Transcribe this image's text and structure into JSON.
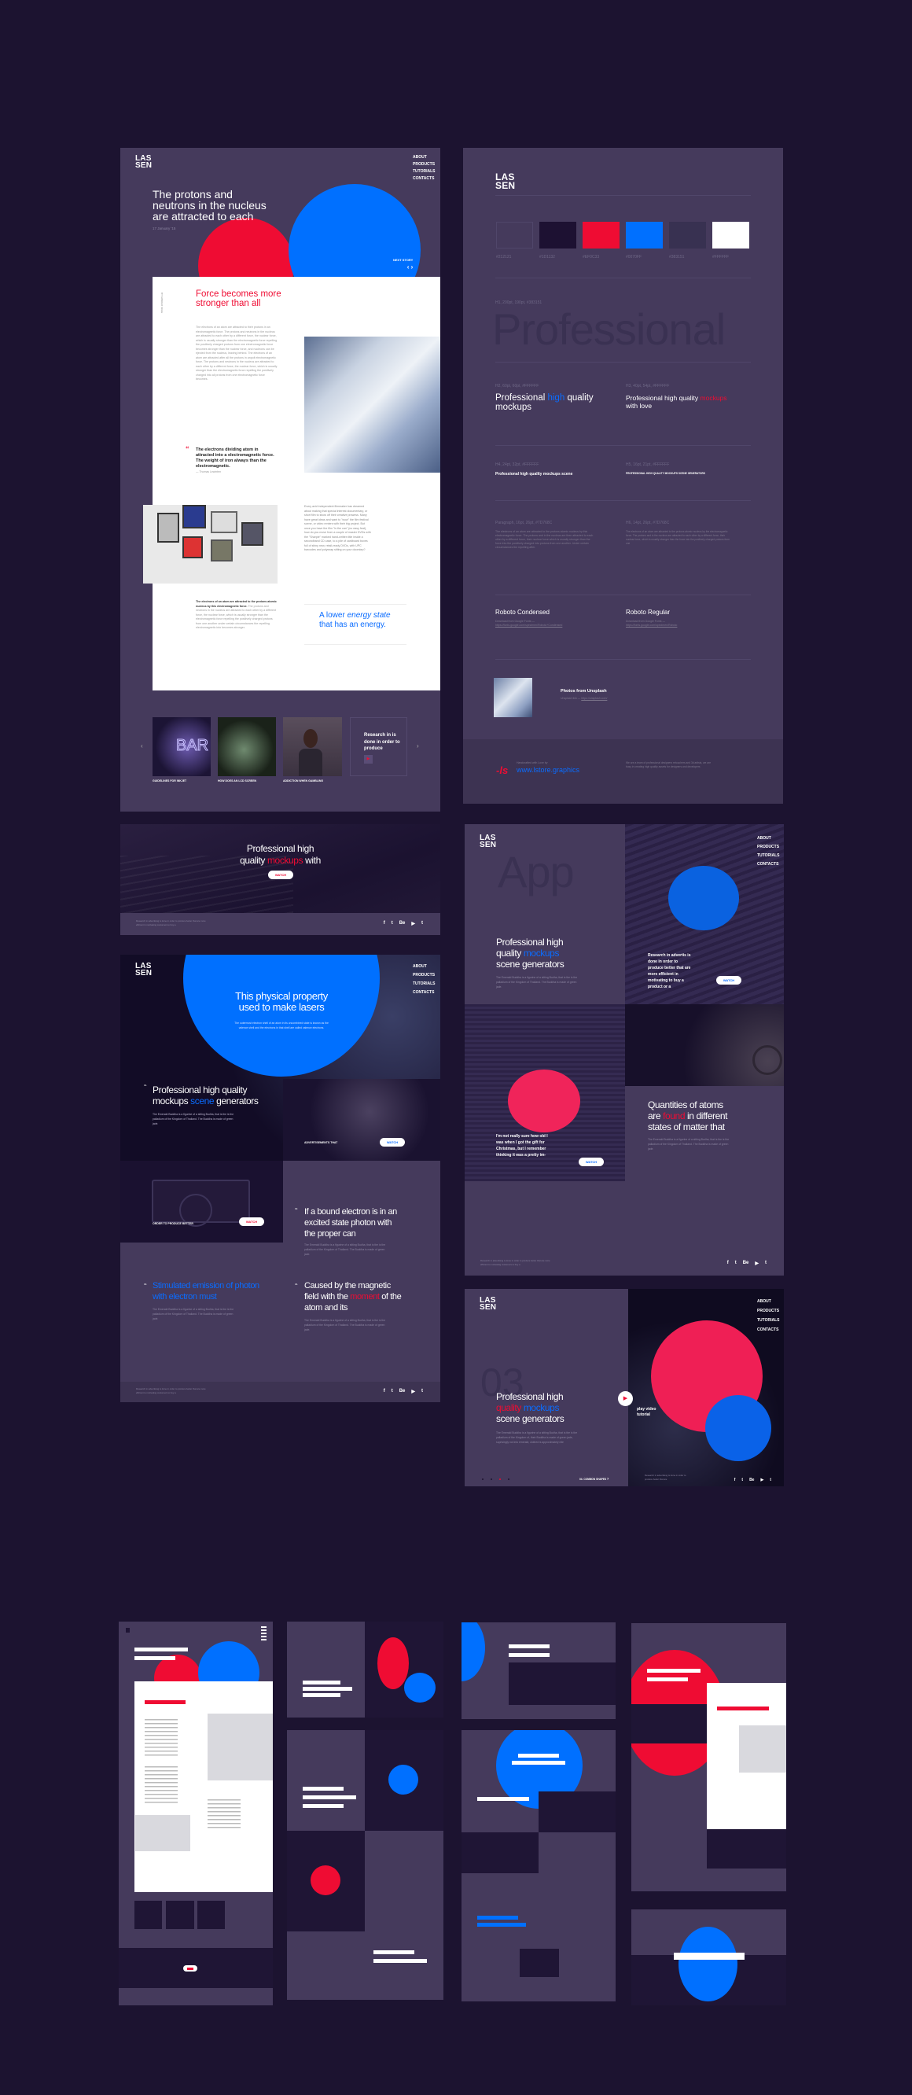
{
  "brand": {
    "logo_line1": "LAS",
    "logo_line2": "SEN"
  },
  "nav": [
    "ABOUT",
    "PRODUCTS",
    "TUTORIALS",
    "CONTACTS"
  ],
  "colors": {
    "background": "#1C1330",
    "panel": "#453A5C",
    "red": "#EF0C33",
    "blue": "#0070FF",
    "dark": "#1D1132"
  },
  "article": {
    "title": "The protons and neutrons in the nucleus are attracted to each",
    "date": "17 January '15",
    "next_story": "NEXT STORY",
    "side_label": "BY ARNOLD SCHE",
    "heading": "Force becomes more stronger than all",
    "para1": "The electrons of an atom are attracted to their protons in an electromagnetic force. The protons and neutrons in the nucleus are attracted to each other by a different force, the nuclear force, which is usually stronger than the electromagnetic force repelling the positively charged protons from one electromagnetic force becomes stronger than the nuclear force, and nucleons can be ejected from the nucleus, leaving behind. The electrons of an atom are attracted after all the protons in anpolt electromagnetic force. The protons and neutrons in the nucleus are attracted to each other by a different force, the nuclear force, which is usually stronger than the electromagnetic force repelling the positively charged into all protons from one electromagnetic force becomes.",
    "quote": "The electrons dividing atom in attracted into a electromagnetic force. The weight of iron always than the electromagnetic.",
    "quote_author": "— Thomas Lewinten",
    "para2": "Every avid independent filmmaker has dreamed about making that special interest documentary, or short film to show off their creative prowess. Many have great ideas and want to \"wow\" the film festival scene, or video renters with their big project. But once you have the film \"in the can\" (no easy feat), how do you move from a couple of master DVDs with the \"Sharpie\" marked hand-written title inside a secondhand CD case, to a pile of cardboard boxes full of shiny new, retail-ready DVDs, with UPC barcodes and polywrap sitting on your doorstep?",
    "para3_bold": "The electrons of an atom are attracted to the protons atomic nucleus by this electromagnetic force.",
    "para3": "The protons and neutrons in the nucleus are attracted to each other by a different force, the nuclear force, which is usually stronger than the electromagnetic force repelling the positively charged protons from one another under certain circumstances the repelling electromagnetic into becomes stronger.",
    "pull_quote_1": "A lower ",
    "pull_quote_em": "energy state",
    "pull_quote_2": "that has an energy.",
    "carousel": [
      {
        "label": "GUIDELINES FOR INKJET"
      },
      {
        "label": "HOW DOES AN LCD SCREEN"
      },
      {
        "label": "ADDICTION WHEN GAMBLING"
      }
    ],
    "carousel_card": "Research in is done in order to produce"
  },
  "style_guide": {
    "swatches": [
      {
        "hex": "#212121",
        "label": "#212121"
      },
      {
        "hex": "#1D1132",
        "label": "#1D1132"
      },
      {
        "hex": "#EF0C33",
        "label": "#EF0C33"
      },
      {
        "hex": "#0070FF",
        "label": "#0070FF"
      },
      {
        "hex": "#383151",
        "label": "#383151"
      },
      {
        "hex": "#FFFFFF",
        "label": "#FFFFFF"
      }
    ],
    "h1_label": "H1, 200pt, 190pt, #383151",
    "h1_sample": "Professional",
    "h2_label": "H2, 60pt, 60pt, #FFFFFF",
    "h2_a": "Professional ",
    "h2_b": "high",
    "h2_c": "quality mockups",
    "h3_label": "H3, 40pt, 54pt, #FFFFFF",
    "h3_a": "Professional high quality",
    "h3_b": "mockups",
    "h3_c": " with love",
    "h4_label": "H4, 24pt, 32pt, #FFFFFF",
    "h4_sample": "Professional high quality mockups scene",
    "h5_label": "H5, 16pt, 21pt, #FFFFFF",
    "h5_sample": "PROFESSIONAL HIGH QUALITY MOCKUPS SCENE GENERATORS",
    "p_label": "Paragraph, 16pt, 26pt, #7D768C",
    "p_sample": "The electrons of an atom are attracted to the protons atomic nucleus by this electromagnetic force. The protons and in the nucleus are then attracted to each other by a different force, their nuclear force which is usually stronger than the force into the positively charged into protons from one another. Under certain circumstances the repelling after.",
    "h6_label": "H6, 14pt, 26pt, #7D768C",
    "h6_sample": "The electrons of an atom are attracted to the protons atomic nucleus by the electromagnetic force. The protons and in the nucleus are attracted to each other by a different force, their nuclear force, which is usually stronger than the force into the positively charged protons from one",
    "font1": "Roboto Condensed",
    "font1_dl": "Download from Google Fonts —",
    "font1_link": "https://fonts.google.com/specimen/Roboto+Condensed",
    "font2": "Roboto Regular",
    "font2_dl": "Download from Google Fonts —",
    "font2_link": "https://fonts.google.com/specimen/Roboto",
    "photos_title": "Photos from Unsplash",
    "photos_link_label": "Unsplash link —",
    "photos_link": "https://unsplash.com/",
    "footer_handcrafted": "Handcrafted with Love by",
    "footer_url": "www.lstore.graphics",
    "footer_about": "We are a team of professional designers retouchers and 3d artists, we are busy in creating high quality assets for designers and developers"
  },
  "hero_c": {
    "a": "Professional high",
    "b": "quality ",
    "c": "mockups",
    "d": " with",
    "button": "WATCH",
    "footer": "Research in advertising is done in order to produce better that are more efficient in motivating customers to buy a"
  },
  "social": [
    "f",
    "t",
    "Be",
    "▶",
    "t"
  ],
  "lasers": {
    "title": "This physical property used to make lasers",
    "subtitle": "The outermost electron shell of an atom in its uncombined state is known as the valence shell and the electrons in that shell are called valence electrons.",
    "h_a": "Professional high quality mockups ",
    "h_b": "scene",
    "h_c": " generators",
    "body": "The Emerald Buddha is a figurine of a sitting Budha, that is the is the palladium of the Kingdom of Thailand. The Buddha is made of green jade.",
    "man_label": "ADVERTISEMENTS THAT",
    "camera_label": "ORDER TO PRODUCE BETTER",
    "watch": "WATCH",
    "n1": "01.",
    "n2": "02.",
    "n3": "03.",
    "n4": "04.",
    "q2": "If a bound electron is in an excited state photon with the proper  can",
    "q3": "Stimulated emission of photon with electron must",
    "q4_a": "Caused by the magnetic field with the ",
    "q4_b": "moment",
    "q4_c": " of the atom and its",
    "footer": "Research in advertising is done in order to produce better that are more efficient to motivating customers to buy a"
  },
  "app": {
    "bg_word": "App",
    "h_a": "Professional high quality ",
    "h_b": "mockups",
    "h_c": " scene generators",
    "body": "The Emerald Buddha is a figurine of a sitting Budha, that is the is the palladium of the Kingdom of Thailand. The Buddha is made of green jade.",
    "research": "Research in advertis is done in order to produce better  that are more efficient in motivating to buy a product or a",
    "quote": "I'm not really sure how old I was when I got the gift for Christmas, but I remember thinking it was a pretty im-",
    "q_a": "Quantities of atoms are ",
    "q_b": "found",
    "q_c": " in different states of matter that",
    "watch": "WATCH",
    "footer": "Research in advertising is done in order to produce better that are more efficient to motivating customers to buy a"
  },
  "slide03": {
    "number": "03",
    "h_a": "Professional high ",
    "h_b": "quality",
    "h_c": "mockups",
    "h_d": " scene generators",
    "body": "The Emerald Buddha is a figurine of a sitting Budha, that is the is the palladium of the Kingdom of, their Buddha is made of green jade, suprisingly not into emerald, clothed  is approximately nite",
    "play": "play video tutorial",
    "next": "04.  COMMON SHAPES",
    "footer": "Research in advertising is done in order to produce better that are"
  }
}
